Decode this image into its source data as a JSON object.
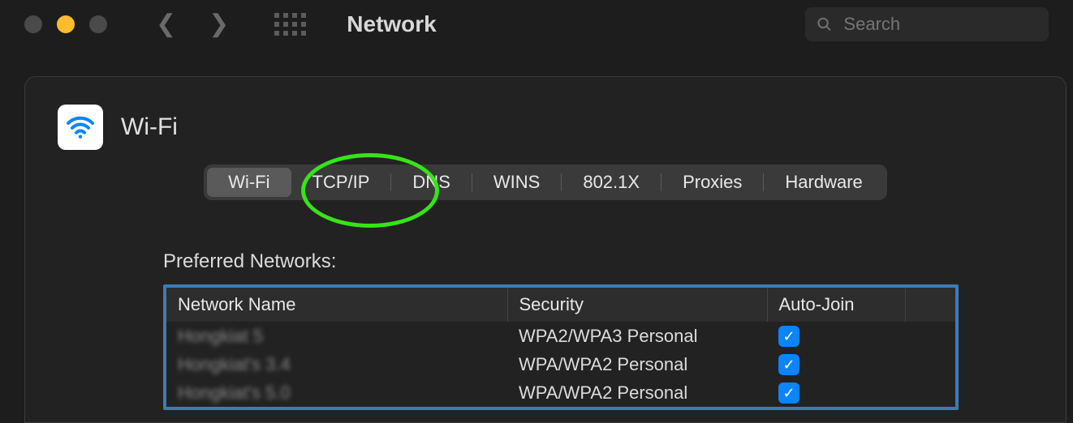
{
  "window": {
    "title": "Network"
  },
  "search": {
    "placeholder": "Search"
  },
  "panel": {
    "title": "Wi-Fi"
  },
  "tabs": [
    {
      "label": "Wi-Fi",
      "selected": true
    },
    {
      "label": "TCP/IP",
      "selected": false
    },
    {
      "label": "DNS",
      "selected": false
    },
    {
      "label": "WINS",
      "selected": false
    },
    {
      "label": "802.1X",
      "selected": false
    },
    {
      "label": "Proxies",
      "selected": false
    },
    {
      "label": "Hardware",
      "selected": false
    }
  ],
  "annotation": {
    "highlighted_tab": "TCP/IP"
  },
  "table": {
    "heading": "Preferred Networks:",
    "columns": [
      "Network Name",
      "Security",
      "Auto-Join"
    ],
    "rows": [
      {
        "name_redacted": true,
        "name_placeholder": "Hongkiat 5",
        "security": "WPA2/WPA3 Personal",
        "auto_join": true
      },
      {
        "name_redacted": true,
        "name_placeholder": "Hongkiat's 3.4",
        "security": "WPA/WPA2 Personal",
        "auto_join": true
      },
      {
        "name_redacted": true,
        "name_placeholder": "Hongkiat's 5.0",
        "security": "WPA/WPA2 Personal",
        "auto_join": true
      }
    ]
  }
}
